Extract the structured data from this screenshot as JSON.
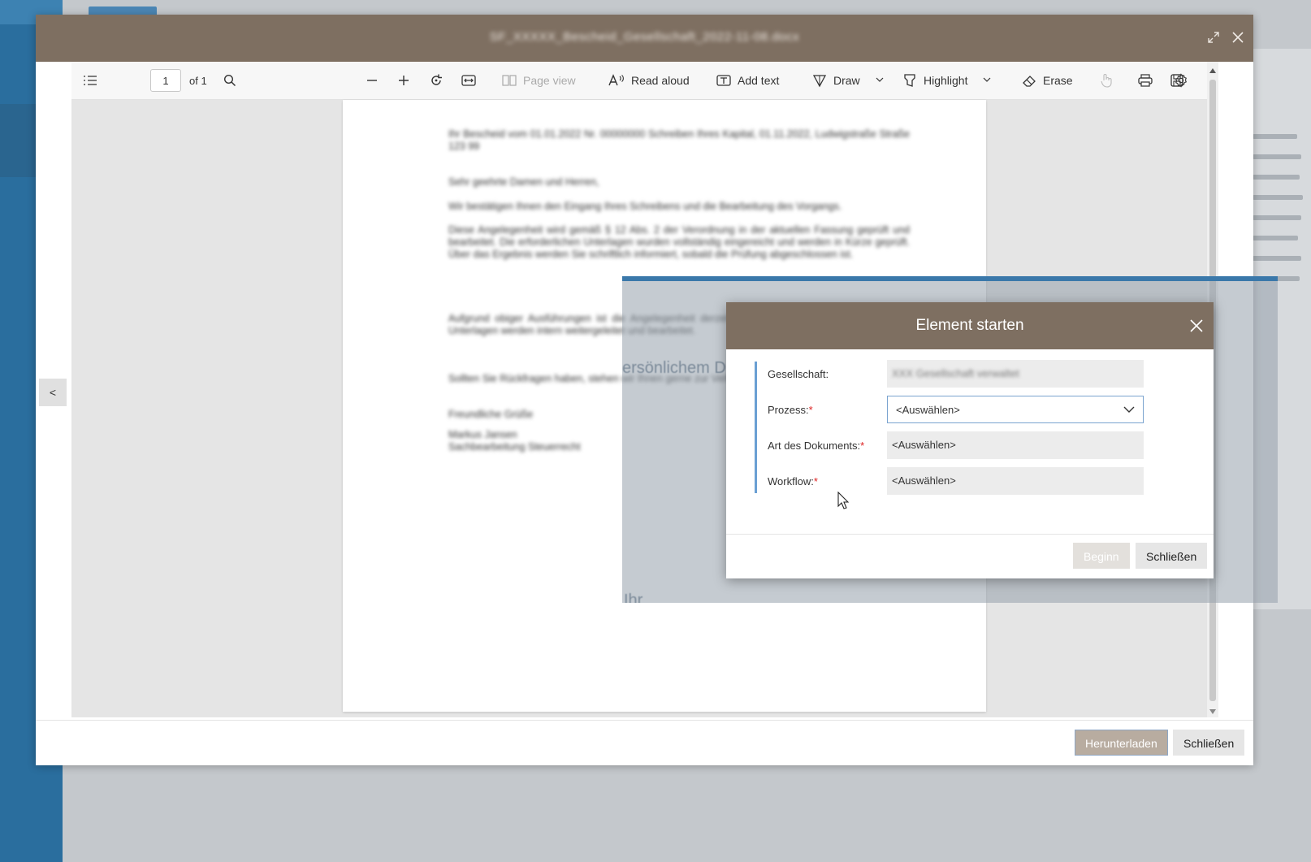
{
  "viewer": {
    "title": "SF_XXXXX_Bescheid_Gesellschaft_2022-11-08.docx",
    "toolbar": {
      "page_number": "1",
      "page_of": "of 1",
      "page_view": "Page view",
      "read_aloud": "Read aloud",
      "add_text": "Add text",
      "draw": "Draw",
      "highlight": "Highlight",
      "erase": "Erase"
    },
    "document_paragraphs": [
      "Ihr Bescheid vom 01.01.2022 Nr. 00000000 Schreiben Ihres Kapital, 01.11.2022, Ludwigstraße Straße 123 99",
      "Sehr geehrte Damen und Herren,",
      "Wir bestätigen Ihnen den Eingang Ihres Schreibens und die Bearbeitung des Vorgangs.",
      "Diese Angelegenheit wird gemäß § 12 Abs. 2 der Verordnung in der aktuellen Fassung geprüft und bearbeitet. Die erforderlichen Unterlagen wurden vollständig eingereicht und werden in Kürze geprüft. Über das Ergebnis werden Sie schriftlich informiert, sobald die Prüfung abgeschlossen ist.",
      "Aufgrund obiger Ausführungen ist die Angelegenheit derzeit nicht abschließend zu bewerten. Die Unterlagen werden intern weitergeleitet und bearbeitet.",
      "Sollten Sie Rückfragen haben, stehen wir Ihnen gerne zur Verfügung.",
      "Freundliche Grüße",
      "Markus Jansen\nSachbearbeitung Steuerrecht"
    ],
    "prev_label": "<",
    "footer": {
      "download": "Herunterladen",
      "close": "Schließen"
    }
  },
  "background": {
    "ghost_text_1": "ersönlichem D",
    "ghost_text_2": "Ihr"
  },
  "dialog": {
    "title": "Element starten",
    "fields": [
      {
        "label": "Gesellschaft:",
        "required": false,
        "value": "XXX Gesellschaft verwaltet"
      },
      {
        "label": "Prozess:",
        "required": true,
        "value": "<Auswählen>"
      },
      {
        "label": "Art des Dokuments:",
        "required": true,
        "value": "<Auswählen>"
      },
      {
        "label": "Workflow:",
        "required": true,
        "value": "<Auswählen>"
      }
    ],
    "required_mark": "*",
    "buttons": {
      "begin": "Beginn",
      "close": "Schließen"
    }
  },
  "colors": {
    "header_brown": "#7e6f61",
    "accent_blue": "#6a9fd3",
    "sidebar_blue": "#2a6e9e"
  }
}
